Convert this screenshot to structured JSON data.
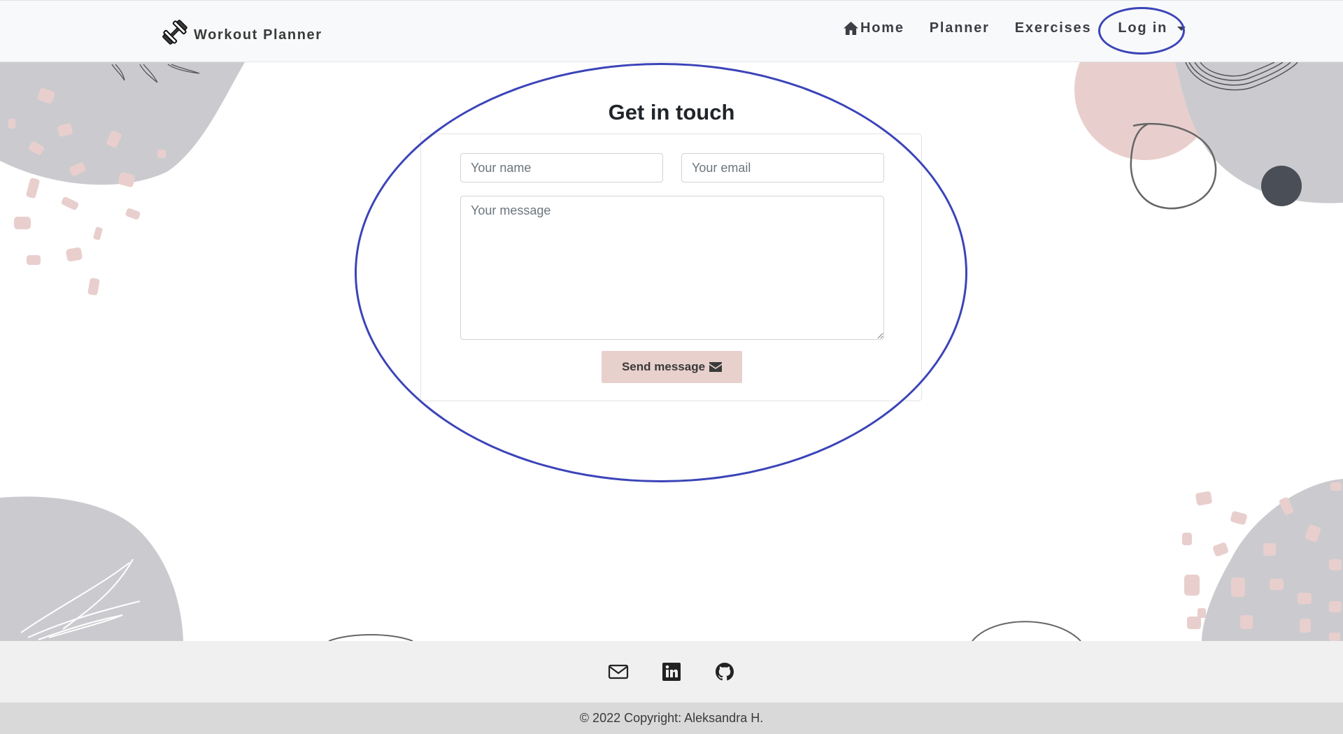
{
  "navbar": {
    "brand": "Workout Planner",
    "links": {
      "home": "Home",
      "planner": "Planner",
      "exercises": "Exercises",
      "login": "Log in"
    }
  },
  "contact": {
    "title": "Get in touch",
    "name_placeholder": "Your name",
    "email_placeholder": "Your email",
    "message_placeholder": "Your message",
    "send_label": "Send message"
  },
  "footer": {
    "icons": [
      "envelope-icon",
      "linkedin-icon",
      "github-icon"
    ],
    "copyright": "© 2022 Copyright: Aleksandra H."
  },
  "colors": {
    "annotation": "#3b44b8",
    "button": "#e8d0cc",
    "blob_gray": "#cbcbcf",
    "blob_pink": "#e8cfcd"
  }
}
